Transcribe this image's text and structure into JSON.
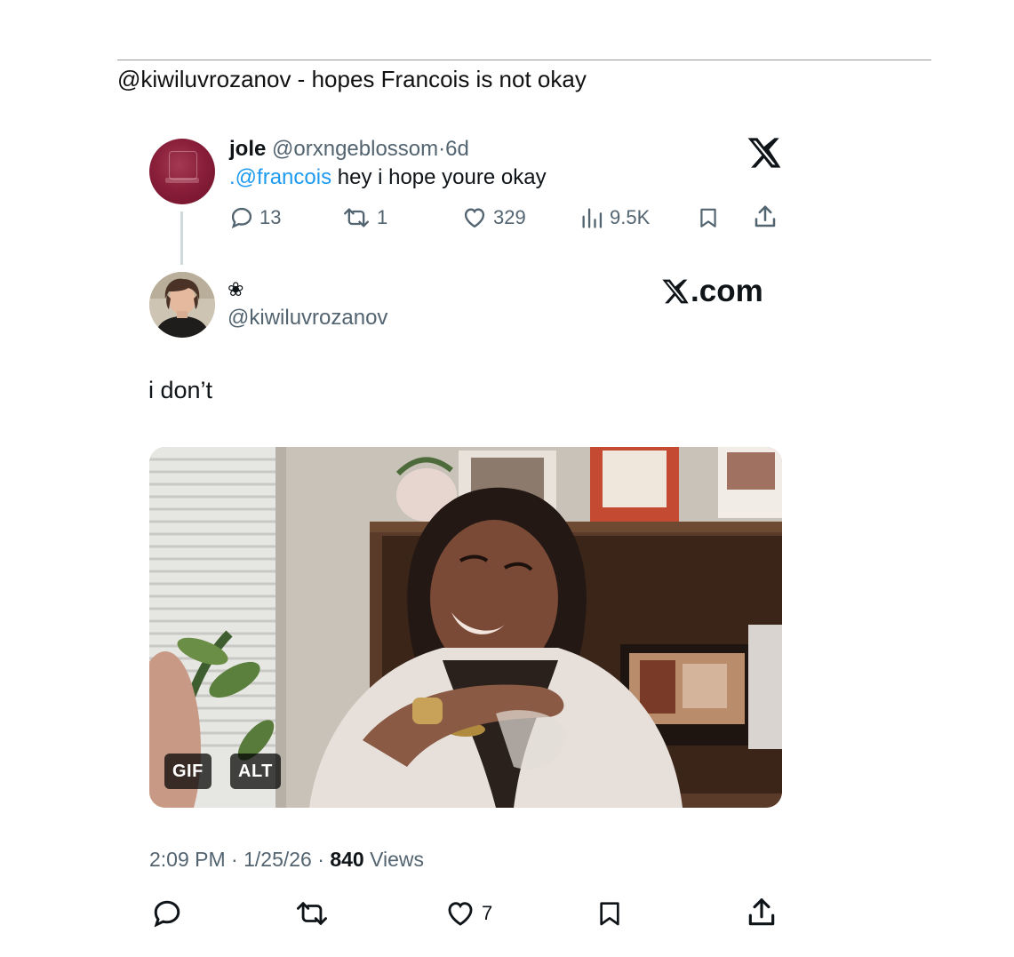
{
  "caption": "@kiwiluvrozanov - hopes Francois is not okay",
  "parent_tweet": {
    "name": "jole",
    "handle": "@orxngeblossom",
    "sep": "·",
    "age": "6d",
    "mention": ".@francois",
    "text": " hey i hope youre okay",
    "replies": "13",
    "reposts": "1",
    "likes": "329",
    "views": "9.5K",
    "platform_icon": "x-logo-icon"
  },
  "main_tweet": {
    "name": "❀",
    "handle": "@kiwiluvrozanov",
    "watermark_suffix": ".com",
    "text": "i don’t",
    "media": {
      "gif_badge": "GIF",
      "alt_badge": "ALT"
    },
    "time": "2:09 PM",
    "date": "1/25/26",
    "views_count": "840",
    "views_label": "Views",
    "sep": "·",
    "likes": "7"
  },
  "colors": {
    "text": "#0f1419",
    "muted": "#536471",
    "link": "#1d9bf0",
    "avatar_maroon": "#8a1f3a"
  }
}
